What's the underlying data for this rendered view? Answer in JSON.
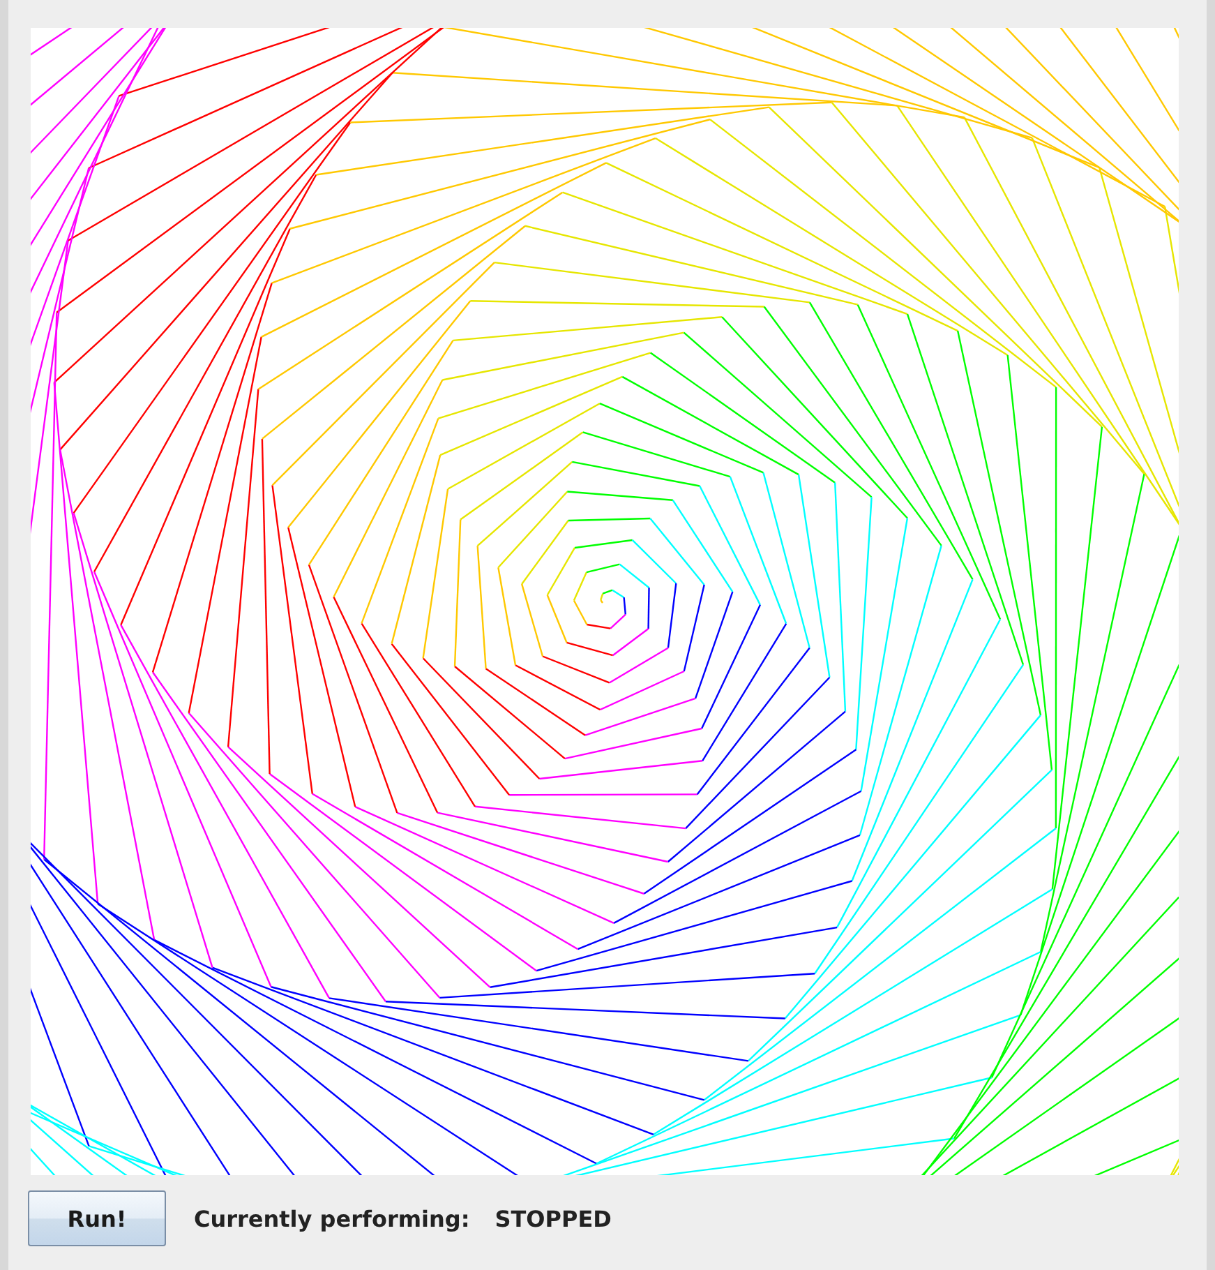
{
  "controls": {
    "run_button": "Run!",
    "status_label": "Currently performing:",
    "status_value": "STOPPED"
  }
}
